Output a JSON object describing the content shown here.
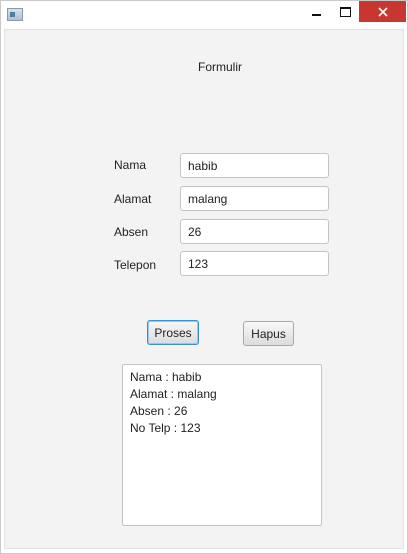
{
  "window": {
    "close_color": "#c7372f"
  },
  "form": {
    "title": "Formulir",
    "fields": [
      {
        "label": "Nama",
        "value": "habib"
      },
      {
        "label": "Alamat",
        "value": "malang"
      },
      {
        "label": "Absen",
        "value": "26"
      },
      {
        "label": "Telepon",
        "value": "123"
      }
    ],
    "proses_label": "Proses",
    "hapus_label": "Hapus"
  },
  "output": {
    "lines": [
      "Nama : habib",
      "Alamat : malang",
      "Absen : 26",
      "No Telp : 123"
    ]
  },
  "icons": {
    "app": "app-window-icon",
    "minimize": "minimize-icon",
    "maximize": "maximize-icon",
    "close": "close-icon"
  }
}
